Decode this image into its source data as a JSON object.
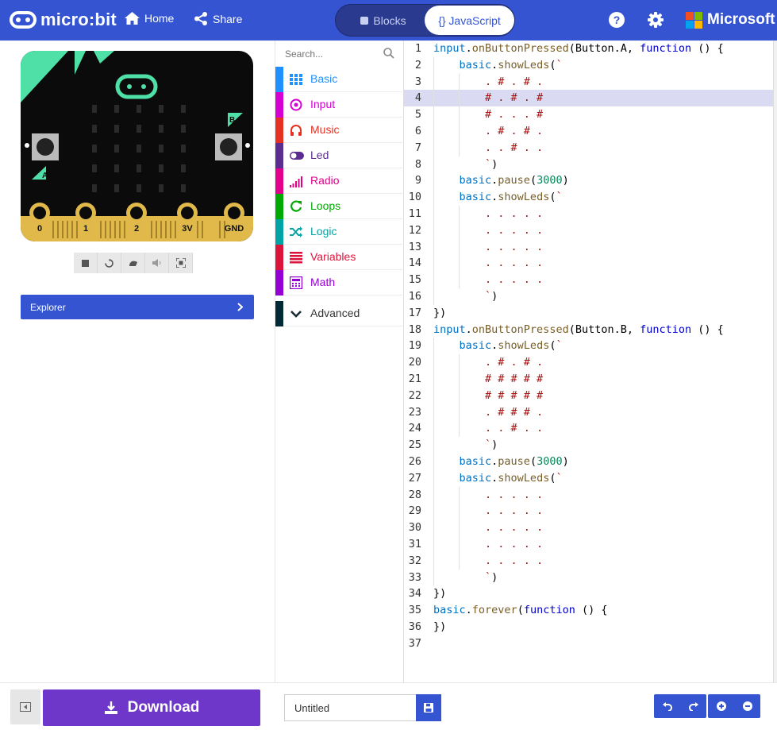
{
  "header": {
    "app_name": "micro:bit",
    "home_label": "Home",
    "share_label": "Share",
    "blocks_label": "Blocks",
    "js_label": "{} JavaScript",
    "brand": "Microsoft",
    "colors": {
      "bg": "#3454d1",
      "accent": "#6e37c9"
    }
  },
  "simulator": {
    "button_a": "A",
    "button_b": "B",
    "pins": [
      "0",
      "1",
      "2",
      "3V",
      "GND"
    ],
    "controls": [
      "stop-icon",
      "restart-icon",
      "slowmo-icon",
      "mute-icon",
      "fullscreen-icon"
    ]
  },
  "explorer": {
    "label": "Explorer"
  },
  "toolbox": {
    "search_placeholder": "Search...",
    "categories": [
      {
        "label": "Basic",
        "color": "#1e90ff",
        "icon": "grid-icon"
      },
      {
        "label": "Input",
        "color": "#d400d4",
        "icon": "target-icon"
      },
      {
        "label": "Music",
        "color": "#e63022",
        "icon": "headphones-icon"
      },
      {
        "label": "Led",
        "color": "#5c2d91",
        "icon": "toggle-icon"
      },
      {
        "label": "Radio",
        "color": "#e3008c",
        "icon": "signal-icon"
      },
      {
        "label": "Loops",
        "color": "#00aa00",
        "icon": "loop-icon"
      },
      {
        "label": "Logic",
        "color": "#00a4a6",
        "icon": "shuffle-icon"
      },
      {
        "label": "Variables",
        "color": "#dc143c",
        "icon": "lines-icon"
      },
      {
        "label": "Math",
        "color": "#9400d3",
        "icon": "calculator-icon"
      }
    ],
    "advanced": {
      "label": "Advanced",
      "color": "#002b36"
    }
  },
  "editor": {
    "lines": [
      "input.onButtonPressed(Button.A, function () {",
      "    basic.showLeds(`",
      "        . # . # .",
      "        # . # . #",
      "        # . . . #",
      "        . # . # .",
      "        . . # . .",
      "        `)",
      "    basic.pause(3000)",
      "    basic.showLeds(`",
      "        . . . . .",
      "        . . . . .",
      "        . . . . .",
      "        . . . . .",
      "        . . . . .",
      "        `)",
      "})",
      "input.onButtonPressed(Button.B, function () {",
      "    basic.showLeds(`",
      "        . # . # .",
      "        # # # # #",
      "        # # # # #",
      "        . # # # .",
      "        . . # . .",
      "        `)",
      "    basic.pause(3000)",
      "    basic.showLeds(`",
      "        . . . . .",
      "        . . . . .",
      "        . . . . .",
      "        . . . . .",
      "        . . . . .",
      "        `)",
      "})",
      "basic.forever(function () {",
      "})",
      ""
    ],
    "highlighted_line": 4
  },
  "bottom": {
    "download_label": "Download",
    "project_name": "Untitled"
  }
}
